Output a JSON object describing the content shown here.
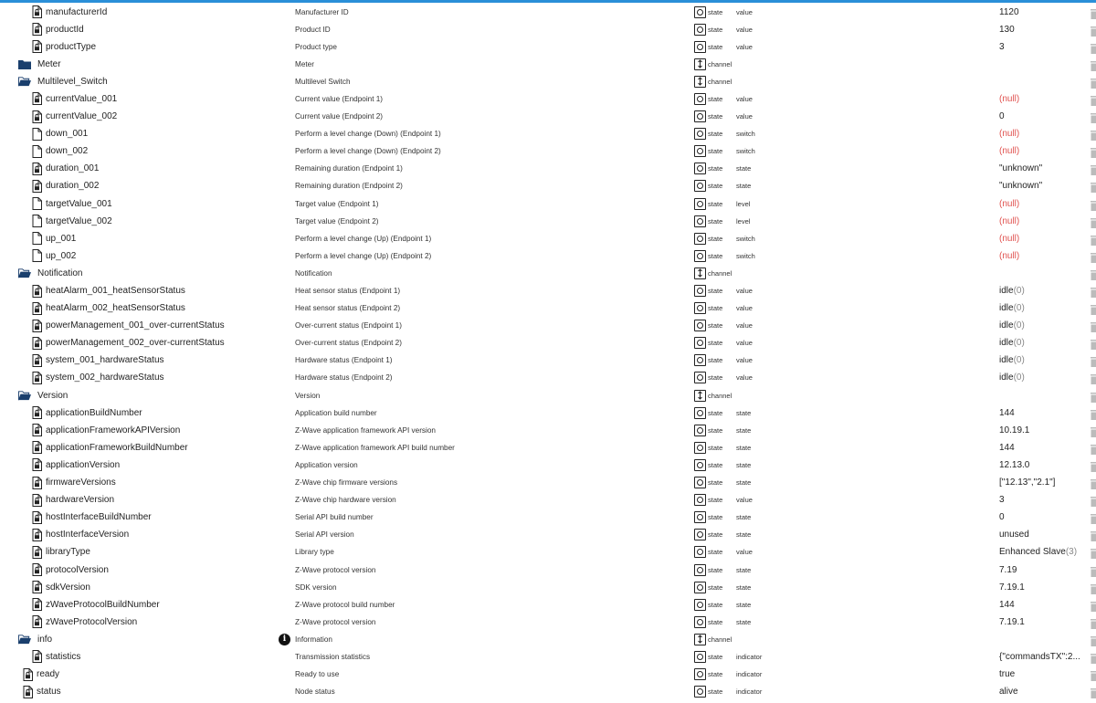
{
  "colors": {
    "accent": "#2a8fd8",
    "folder": "#1a3f6d",
    "null_value": "#e0524f"
  },
  "rows": [
    {
      "kind": "state",
      "depth": 1,
      "name": "manufacturerId",
      "desc": "Manufacturer ID",
      "type": "state",
      "role": "value",
      "val": "1120",
      "lock": true
    },
    {
      "kind": "state",
      "depth": 1,
      "name": "productId",
      "desc": "Product ID",
      "type": "state",
      "role": "value",
      "val": "130",
      "lock": true
    },
    {
      "kind": "state",
      "depth": 1,
      "name": "productType",
      "desc": "Product type",
      "type": "state",
      "role": "value",
      "val": "3",
      "lock": true
    },
    {
      "kind": "folder",
      "depth": 0,
      "open": false,
      "name": "Meter",
      "desc": "Meter",
      "type": "channel"
    },
    {
      "kind": "folder",
      "depth": 0,
      "open": true,
      "name": "Multilevel_Switch",
      "desc": "Multilevel Switch",
      "type": "channel"
    },
    {
      "kind": "state",
      "depth": 1,
      "name": "currentValue_001",
      "desc": "Current value (Endpoint 1)",
      "type": "state",
      "role": "value",
      "val": "(null)",
      "valClass": "null",
      "lock": true
    },
    {
      "kind": "state",
      "depth": 1,
      "name": "currentValue_002",
      "desc": "Current value (Endpoint 2)",
      "type": "state",
      "role": "value",
      "val": "0",
      "lock": true
    },
    {
      "kind": "state",
      "depth": 1,
      "name": "down_001",
      "desc": "Perform a level change (Down) (Endpoint 1)",
      "type": "state",
      "role": "switch",
      "val": "(null)",
      "valClass": "null",
      "lock": false
    },
    {
      "kind": "state",
      "depth": 1,
      "name": "down_002",
      "desc": "Perform a level change (Down) (Endpoint 2)",
      "type": "state",
      "role": "switch",
      "val": "(null)",
      "valClass": "null",
      "lock": false
    },
    {
      "kind": "state",
      "depth": 1,
      "name": "duration_001",
      "desc": "Remaining duration (Endpoint 1)",
      "type": "state",
      "role": "state",
      "val": "\"unknown\"",
      "lock": true
    },
    {
      "kind": "state",
      "depth": 1,
      "name": "duration_002",
      "desc": "Remaining duration (Endpoint 2)",
      "type": "state",
      "role": "state",
      "val": "\"unknown\"",
      "lock": true
    },
    {
      "kind": "state",
      "depth": 1,
      "name": "targetValue_001",
      "desc": "Target value (Endpoint 1)",
      "type": "state",
      "role": "level",
      "val": "(null)",
      "valClass": "null",
      "lock": false
    },
    {
      "kind": "state",
      "depth": 1,
      "name": "targetValue_002",
      "desc": "Target value (Endpoint 2)",
      "type": "state",
      "role": "level",
      "val": "(null)",
      "valClass": "null",
      "lock": false
    },
    {
      "kind": "state",
      "depth": 1,
      "name": "up_001",
      "desc": "Perform a level change (Up) (Endpoint 1)",
      "type": "state",
      "role": "switch",
      "val": "(null)",
      "valClass": "null",
      "lock": false
    },
    {
      "kind": "state",
      "depth": 1,
      "name": "up_002",
      "desc": "Perform a level change (Up) (Endpoint 2)",
      "type": "state",
      "role": "switch",
      "val": "(null)",
      "valClass": "null",
      "lock": false
    },
    {
      "kind": "folder",
      "depth": 0,
      "open": true,
      "name": "Notification",
      "desc": "Notification",
      "type": "channel"
    },
    {
      "kind": "state",
      "depth": 1,
      "name": "heatAlarm_001_heatSensorStatus",
      "desc": "Heat sensor status (Endpoint 1)",
      "type": "state",
      "role": "value",
      "val": "idle",
      "valSuffix": "(0)",
      "lock": true
    },
    {
      "kind": "state",
      "depth": 1,
      "name": "heatAlarm_002_heatSensorStatus",
      "desc": "Heat sensor status (Endpoint 2)",
      "type": "state",
      "role": "value",
      "val": "idle",
      "valSuffix": "(0)",
      "lock": true
    },
    {
      "kind": "state",
      "depth": 1,
      "name": "powerManagement_001_over-currentStatus",
      "desc": "Over-current status (Endpoint 1)",
      "type": "state",
      "role": "value",
      "val": "idle",
      "valSuffix": "(0)",
      "lock": true
    },
    {
      "kind": "state",
      "depth": 1,
      "name": "powerManagement_002_over-currentStatus",
      "desc": "Over-current status (Endpoint 2)",
      "type": "state",
      "role": "value",
      "val": "idle",
      "valSuffix": "(0)",
      "lock": true
    },
    {
      "kind": "state",
      "depth": 1,
      "name": "system_001_hardwareStatus",
      "desc": "Hardware status (Endpoint 1)",
      "type": "state",
      "role": "value",
      "val": "idle",
      "valSuffix": "(0)",
      "lock": true
    },
    {
      "kind": "state",
      "depth": 1,
      "name": "system_002_hardwareStatus",
      "desc": "Hardware status (Endpoint 2)",
      "type": "state",
      "role": "value",
      "val": "idle",
      "valSuffix": "(0)",
      "lock": true
    },
    {
      "kind": "folder",
      "depth": 0,
      "open": true,
      "name": "Version",
      "desc": "Version",
      "type": "channel"
    },
    {
      "kind": "state",
      "depth": 1,
      "name": "applicationBuildNumber",
      "desc": "Application build number",
      "type": "state",
      "role": "state",
      "val": "144",
      "lock": true
    },
    {
      "kind": "state",
      "depth": 1,
      "name": "applicationFrameworkAPIVersion",
      "desc": "Z-Wave application framework API version",
      "type": "state",
      "role": "state",
      "val": "10.19.1",
      "lock": true
    },
    {
      "kind": "state",
      "depth": 1,
      "name": "applicationFrameworkBuildNumber",
      "desc": "Z-Wave application framework API build number",
      "type": "state",
      "role": "state",
      "val": "144",
      "lock": true
    },
    {
      "kind": "state",
      "depth": 1,
      "name": "applicationVersion",
      "desc": "Application version",
      "type": "state",
      "role": "state",
      "val": "12.13.0",
      "lock": true
    },
    {
      "kind": "state",
      "depth": 1,
      "name": "firmwareVersions",
      "desc": "Z-Wave chip firmware versions",
      "type": "state",
      "role": "state",
      "val": "[\"12.13\",\"2.1\"]",
      "lock": true
    },
    {
      "kind": "state",
      "depth": 1,
      "name": "hardwareVersion",
      "desc": "Z-Wave chip hardware version",
      "type": "state",
      "role": "value",
      "val": "3",
      "lock": true
    },
    {
      "kind": "state",
      "depth": 1,
      "name": "hostInterfaceBuildNumber",
      "desc": "Serial API build number",
      "type": "state",
      "role": "state",
      "val": "0",
      "lock": true
    },
    {
      "kind": "state",
      "depth": 1,
      "name": "hostInterfaceVersion",
      "desc": "Serial API version",
      "type": "state",
      "role": "state",
      "val": "unused",
      "lock": true
    },
    {
      "kind": "state",
      "depth": 1,
      "name": "libraryType",
      "desc": "Library type",
      "type": "state",
      "role": "value",
      "val": "Enhanced Slave",
      "valSuffix": "(3)",
      "lock": true
    },
    {
      "kind": "state",
      "depth": 1,
      "name": "protocolVersion",
      "desc": "Z-Wave protocol version",
      "type": "state",
      "role": "state",
      "val": "7.19",
      "lock": true
    },
    {
      "kind": "state",
      "depth": 1,
      "name": "sdkVersion",
      "desc": "SDK version",
      "type": "state",
      "role": "state",
      "val": "7.19.1",
      "lock": true
    },
    {
      "kind": "state",
      "depth": 1,
      "name": "zWaveProtocolBuildNumber",
      "desc": "Z-Wave protocol build number",
      "type": "state",
      "role": "state",
      "val": "144",
      "lock": true
    },
    {
      "kind": "state",
      "depth": 1,
      "name": "zWaveProtocolVersion",
      "desc": "Z-Wave protocol version",
      "type": "state",
      "role": "state",
      "val": "7.19.1",
      "lock": true
    },
    {
      "kind": "folder",
      "depth": 0,
      "open": true,
      "name": "info",
      "desc": "Information",
      "type": "channel",
      "infoIcon": true
    },
    {
      "kind": "state",
      "depth": 1,
      "name": "statistics",
      "desc": "Transmission statistics",
      "type": "state",
      "role": "indicator",
      "val": "{\"commandsTX\":2...",
      "lock": true
    },
    {
      "kind": "state",
      "depth": 0,
      "name": "ready",
      "desc": "Ready to use",
      "type": "state",
      "role": "indicator",
      "val": "true",
      "lock": true
    },
    {
      "kind": "state",
      "depth": 0,
      "name": "status",
      "desc": "Node status",
      "type": "state",
      "role": "indicator",
      "val": "alive",
      "lock": true
    }
  ]
}
